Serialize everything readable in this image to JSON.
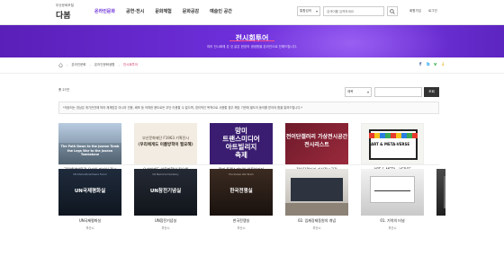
{
  "header": {
    "logo_small": "부산문화포털",
    "logo_big": "다봄",
    "nav": [
      "온라인문화",
      "공연·전시",
      "문화체험",
      "문화공감",
      "예술인 공간"
    ],
    "active_nav": 0,
    "search_select": "통합검색",
    "search_placeholder": "검색어를 입력하세요",
    "util_links": [
      "회원가입",
      "로그인"
    ]
  },
  "banner": {
    "title": "전시회투어",
    "subtitle": "여러 전시회에 온 것 같은 현장의 생생함을 온라인으로 전해드립니다."
  },
  "breadcrumb": [
    "온라인문화",
    "온라인문화생활",
    "전시회투어"
  ],
  "share_icons": [
    "facebook-icon",
    "twitter-icon",
    "line-icon",
    "bookmark-icon"
  ],
  "list": {
    "count": "총 27건",
    "sort": "제목",
    "search_button": "조회",
    "notice": "*게공되는 영상은 위기관전에 따라 제재받은 아니라 전용, 배포 등 어떠한 용도로든 무단 이용할 수 없으며, 영리적인 목적으로 사용할 경우 해당 기관에 별도의 동의를 받아야 함을 알려드립니다.*"
  },
  "cards_row1": [
    {
      "thumb_text": "The Path Down to the Joseon Tomb\nthe Legs War to the Joseon Tombstone",
      "caption": "국립해양박물관 온라인 미디어 전시",
      "org": "국립해양박물관"
    },
    {
      "thumb_text1": "부산문화재단 F1963 기획전시",
      "thumb_text2": "〈우리에게도 이름방학이 필요해〉",
      "caption": "우리에게도 이름방학이 필요해",
      "org": "부산문화재단"
    },
    {
      "thumb_text": "망미\n트랜스미디어\n아트빌리지\n축제",
      "caption": "망미 트랜스미디어 아트빌리지",
      "org": "(재)부산문화시도시재생지원센터"
    },
    {
      "thumb_text": "전이단갤러리 가상전시공간\n전시리스트",
      "caption": "전이단갤러리 가상전시공간",
      "org": "부산문화재단"
    },
    {
      "thumb_text": "ART & META-VERSE",
      "caption": "ART & META - VERSE",
      "org": "유리하우스"
    }
  ],
  "cards_row2": [
    {
      "thumb_small": "UN International Peace Forum",
      "thumb_text": "UN국제평화실",
      "caption": "UN국제평화실",
      "org": "부산시"
    },
    {
      "thumb_small": "UN Memorial Cemetery",
      "thumb_text": "UN참전기념실",
      "caption": "UN참전기념실",
      "org": "부산시"
    },
    {
      "thumb_small": "The Korean War Room",
      "thumb_text": "한국전쟁실",
      "caption": "한국전쟁실",
      "org": "부산시"
    },
    {
      "thumb_text": "",
      "caption": "02. 임제강제동원의 개념",
      "org": "부산시"
    },
    {
      "thumb_text": "",
      "caption": "01. 기억의 터널",
      "org": "부산시"
    },
    {
      "thumb_text": "",
      "caption": "",
      "org": ""
    }
  ]
}
